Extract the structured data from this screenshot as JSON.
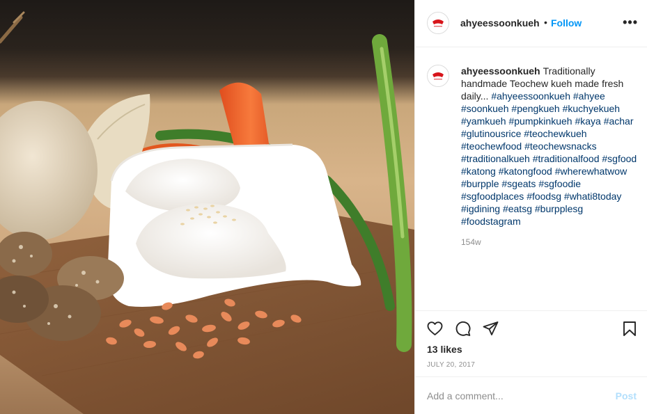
{
  "post": {
    "username": "ahyeessoonkueh",
    "follow_label": "Follow",
    "separator": "•",
    "more_label": "•••",
    "caption_text": "Traditionally handmade Teochew kueh made fresh daily...",
    "hashtags": [
      "#ahyeessoonkueh",
      "#ahyee",
      "#soonkueh",
      "#pengkueh",
      "#kuchyekueh",
      "#yamkueh",
      "#pumpkinkueh",
      "#kaya",
      "#achar",
      "#glutinousrice",
      "#teochewkueh",
      "#teochewfood",
      "#teochewsnacks",
      "#traditionalkueh",
      "#traditionalfood",
      "#sgfood",
      "#katong",
      "#katongfood",
      "#wherewhatwow",
      "#burpple",
      "#sgeats",
      "#sgfoodie",
      "#sgfoodplaces",
      "#foodsg",
      "#whati8today",
      "#igdining",
      "#eatsg",
      "#burpplesg",
      "#foodstagram"
    ],
    "time_ago": "154w",
    "likes": "13 likes",
    "date": "JULY 20, 2017"
  },
  "actions": {
    "icons": [
      "heart-icon",
      "comment-icon",
      "share-icon",
      "bookmark-icon"
    ]
  },
  "comment": {
    "placeholder": "Add a comment...",
    "post_label": "Post"
  },
  "colors": {
    "link": "#0095f6",
    "hashtag": "#00376b",
    "muted": "#8e8e8e",
    "post_disabled": "#b2dffc",
    "avatar_red": "#d7141a"
  }
}
